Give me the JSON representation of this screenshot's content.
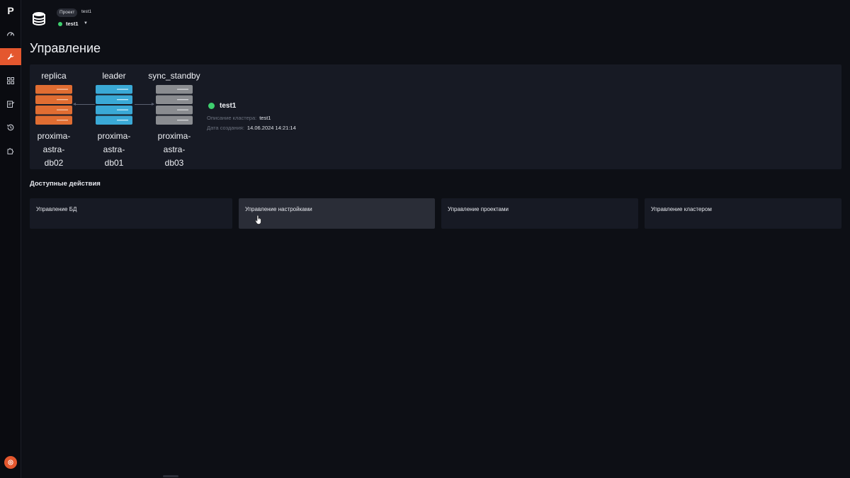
{
  "app": {
    "logo": "P"
  },
  "header": {
    "project_chip": "Проект",
    "project_name_top": "test1",
    "project_select": "test1"
  },
  "page": {
    "title": "Управление"
  },
  "cluster": {
    "nodes": [
      {
        "role": "replica",
        "host_lines": [
          "proxima-",
          "astra-",
          "db02"
        ],
        "color": "#e06d32"
      },
      {
        "role": "leader",
        "host_lines": [
          "proxima-",
          "astra-",
          "db01"
        ],
        "color": "#3aa9d6"
      },
      {
        "role": "sync_standby",
        "host_lines": [
          "proxima-",
          "astra-",
          "db03"
        ],
        "color": "#8a8c90"
      }
    ],
    "name": "test1",
    "description_label": "Описание кластера:",
    "description_value": "test1",
    "created_label": "Дата создания:",
    "created_value": "14.06.2024 14:21:14",
    "status_color": "#3ecf6e"
  },
  "actions": {
    "section_title": "Доступные действия",
    "items": [
      {
        "label": "Управление БД"
      },
      {
        "label": "Управление настройками"
      },
      {
        "label": "Управление проектами"
      },
      {
        "label": "Управление кластером"
      }
    ]
  },
  "colors": {
    "accent": "#e4572e",
    "success": "#3ecf6e",
    "panel": "#171a24",
    "background": "#0d0f15"
  },
  "sidebar": {
    "icons": [
      "dashboard-icon",
      "wrench-icon",
      "grid-icon",
      "document-edit-icon",
      "history-icon",
      "puzzle-icon"
    ],
    "active_index": 1,
    "bottom_icon": "support-icon"
  }
}
